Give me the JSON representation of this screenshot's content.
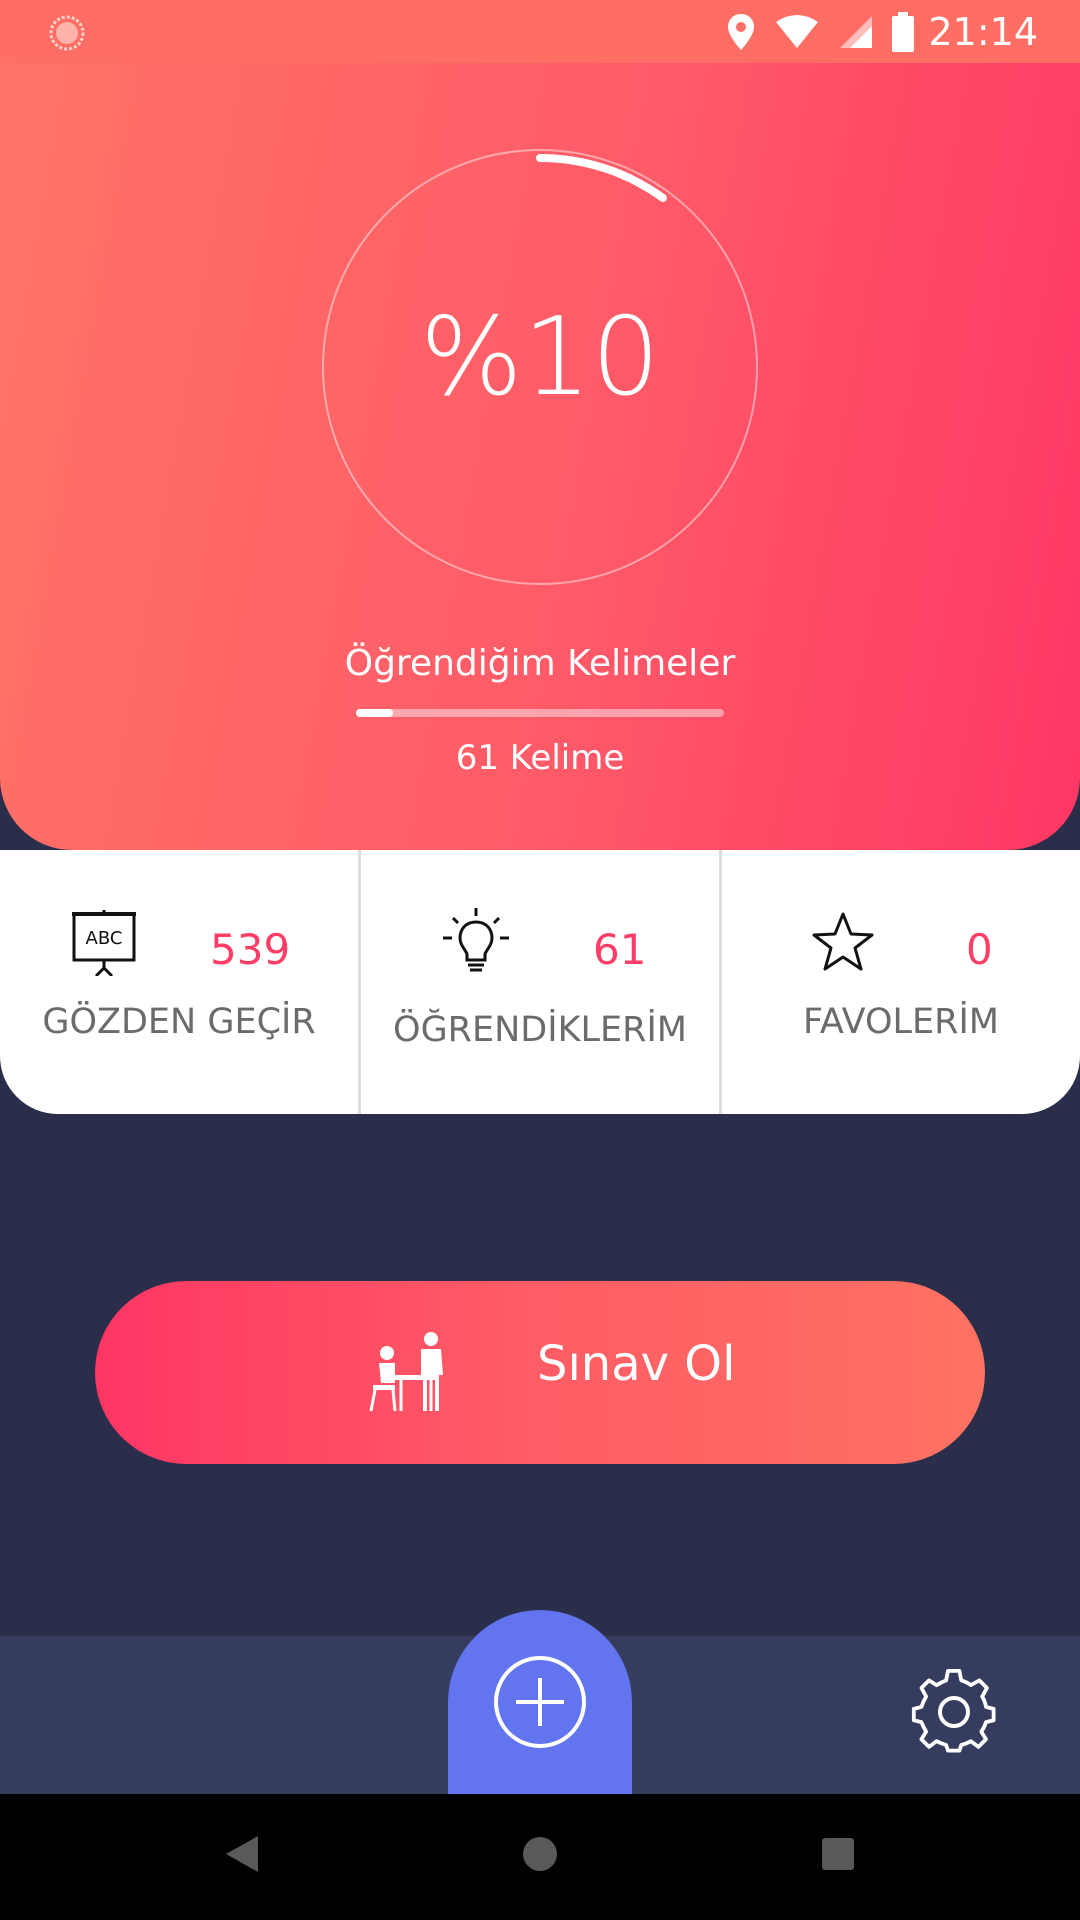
{
  "status_bar": {
    "time": "21:14"
  },
  "hero": {
    "percent": "%10",
    "progress": 0.1,
    "title": "Öğrendiğim Kelimeler",
    "word_count": "61 Kelime"
  },
  "stats": [
    {
      "icon": "abc-board-icon",
      "value": "539",
      "label": "GÖZDEN GEÇİR"
    },
    {
      "icon": "lightbulb-icon",
      "value": "61",
      "label": "ÖĞRENDİKLERİM"
    },
    {
      "icon": "star-icon",
      "value": "0",
      "label": "FAVOLERİM"
    }
  ],
  "exam": {
    "icon": "exam-desk-icon",
    "label": "Sınav Ol"
  },
  "bottom_nav": {
    "fab_icon": "add-icon",
    "settings_icon": "gear-icon"
  },
  "colors": {
    "accent": "#ff3d67",
    "hero_start": "#ff7466",
    "hero_end": "#ff3664",
    "background": "#2a2e4a",
    "fab": "#6274ee",
    "nav": "#363c5e"
  }
}
